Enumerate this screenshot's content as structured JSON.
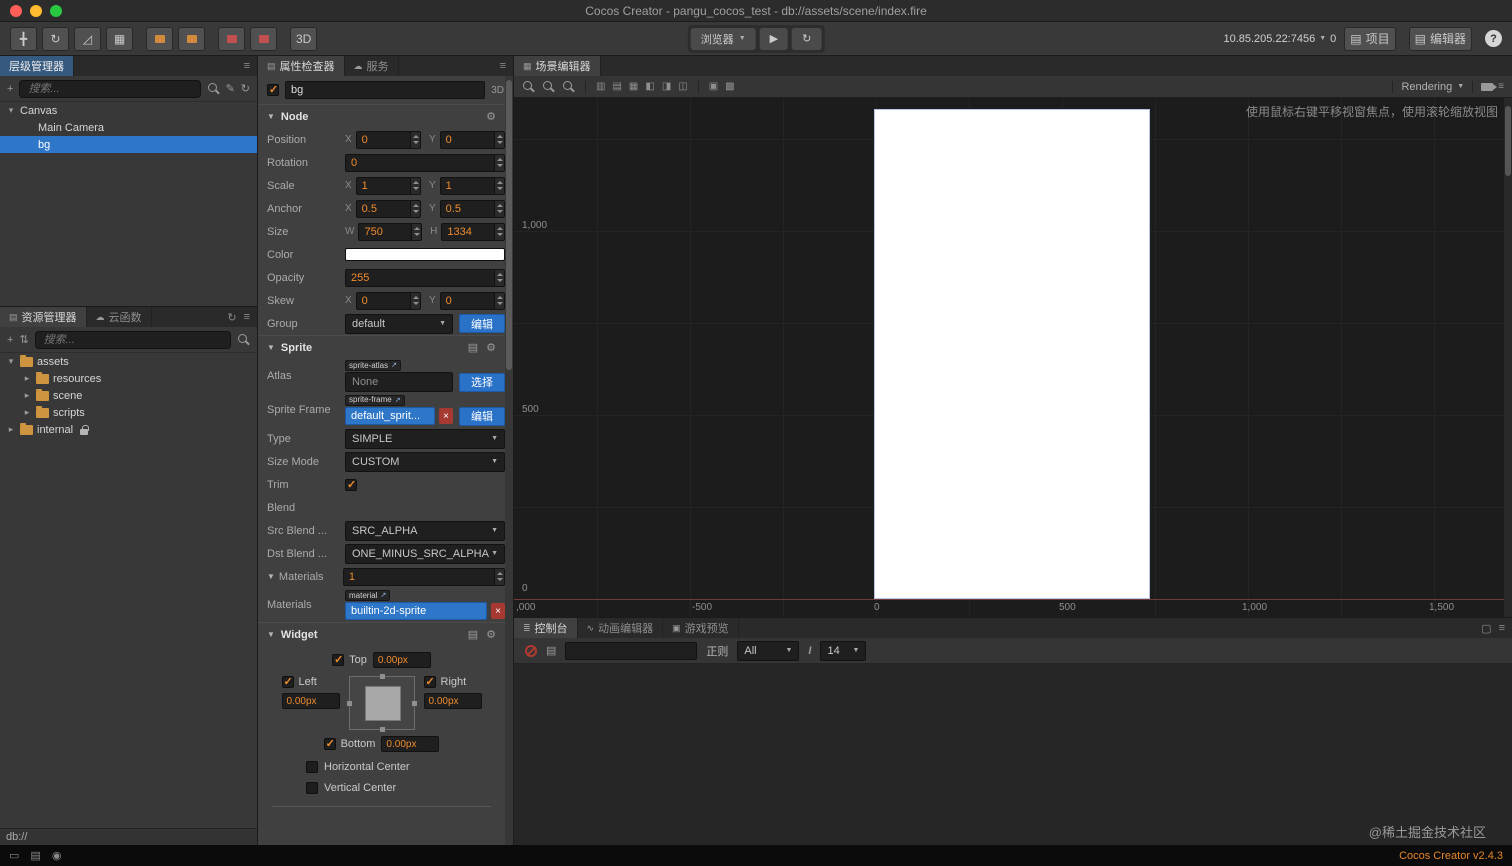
{
  "theme": {
    "accent_blue": "#2d76c8",
    "value_orange": "#f08c2e",
    "button_blue": "#2a72c8",
    "folder_orange": "#cf9440",
    "version_orange": "#e8862a",
    "gizmo_green": "#3aa83a",
    "gizmo_red": "#b03325",
    "gizmo_handle_blue": "#9191e0"
  },
  "icons": {
    "move": "╋",
    "rotate": "↻",
    "scale": "◿",
    "rect": "▦",
    "play": "▶",
    "refresh": "↻",
    "dropdown": "▼",
    "tree_open": "▾",
    "tree_closed": "▸",
    "fold_open": "▼",
    "menu": "≡",
    "add": "+",
    "edit_pencil": "✎",
    "sort": "⇅",
    "gear": "⚙",
    "doc": "▤",
    "link": "↗",
    "close": "×",
    "cloud": "☁",
    "wave": "∿",
    "game": "▣",
    "console": "≣",
    "props": "▤",
    "scene": "▦",
    "assets_tab": "▤",
    "expand": "▢",
    "eye": "◉",
    "monitor": "▭",
    "list": "▤",
    "align1": "▥",
    "align2": "▤",
    "align3": "▦",
    "align4": "◧",
    "align5": "◨",
    "align6": "◫",
    "align7": "▣",
    "align8": "▩",
    "folder_btn": "▤",
    "i_text": "I"
  },
  "titlebar": {
    "title": "Cocos Creator - pangu_cocos_test - db://assets/scene/index.fire"
  },
  "toolbar": {
    "mode_3d": "3D",
    "preview_target": "浏览器",
    "address": "10.85.205.22:7456",
    "connection_count": "0",
    "project_label": "项目",
    "editor_label": "编辑器",
    "help_label": "?"
  },
  "hierarchy": {
    "tab_label": "层级管理器",
    "search_placeholder": "搜索...",
    "nodes": [
      {
        "label": "Canvas"
      },
      {
        "label": "Main Camera"
      },
      {
        "label": "bg"
      }
    ]
  },
  "assets": {
    "tab_assets": "资源管理器",
    "tab_cloud": "云函数",
    "search_placeholder": "搜索...",
    "nodes": [
      {
        "label": "assets"
      },
      {
        "label": "resources"
      },
      {
        "label": "scene"
      },
      {
        "label": "scripts"
      },
      {
        "label": "internal"
      }
    ],
    "footer_path": "db://"
  },
  "inspector": {
    "tab_properties": "属性检查器",
    "tab_services": "服务",
    "node_name": "bg",
    "badge_3d": "3D",
    "node": {
      "title": "Node",
      "x_label": "X",
      "y_label": "Y",
      "w_label": "W",
      "h_label": "H",
      "position_label": "Position",
      "position_x": "0",
      "position_y": "0",
      "rotation_label": "Rotation",
      "rotation_value": "0",
      "scale_label": "Scale",
      "scale_x": "1",
      "scale_y": "1",
      "anchor_label": "Anchor",
      "anchor_x": "0.5",
      "anchor_y": "0.5",
      "size_label": "Size",
      "size_w": "750",
      "size_h": "1334",
      "color_label": "Color",
      "opacity_label": "Opacity",
      "opacity_value": "255",
      "skew_label": "Skew",
      "skew_x": "0",
      "skew_y": "0",
      "group_label": "Group",
      "group_value": "default",
      "group_edit_label": "编辑"
    },
    "sprite": {
      "title": "Sprite",
      "atlas_label": "Atlas",
      "atlas_tag": "sprite-atlas",
      "atlas_value": "None",
      "atlas_btn": "选择",
      "frame_label": "Sprite Frame",
      "frame_tag": "sprite-frame",
      "frame_value": "default_sprit...",
      "frame_btn": "编辑",
      "type_label": "Type",
      "type_value": "SIMPLE",
      "sizemode_label": "Size Mode",
      "sizemode_value": "CUSTOM",
      "trim_label": "Trim",
      "blend_label": "Blend",
      "src_blend_label": "Src Blend ...",
      "src_blend_value": "SRC_ALPHA",
      "dst_blend_label": "Dst Blend ...",
      "dst_blend_value": "ONE_MINUS_SRC_ALPHA",
      "materials_title": "Materials",
      "materials_count": "1",
      "materials_label": "Materials",
      "material_tag": "material",
      "material_value": "builtin-2d-sprite"
    },
    "widget": {
      "title": "Widget",
      "top_label": "Top",
      "top_value": "0.00px",
      "left_label": "Left",
      "left_value": "0.00px",
      "right_label": "Right",
      "right_value": "0.00px",
      "bottom_label": "Bottom",
      "bottom_value": "0.00px",
      "h_center_label": "Horizontal Center",
      "v_center_label": "Vertical Center"
    }
  },
  "scene": {
    "tab_label": "场景编辑器",
    "rendering_label": "Rendering",
    "hint": "使用鼠标右键平移视窗焦点，使用滚轮缩放视图",
    "ruler_y": [
      "1,000",
      "500",
      "0"
    ],
    "ruler_x": [
      ",000",
      "-500",
      "0",
      "500",
      "1,000",
      "1,500"
    ]
  },
  "console": {
    "tab_console": "控制台",
    "tab_animation": "动画编辑器",
    "tab_preview": "游戏预览",
    "regex_label": "正则",
    "filter_value": "All",
    "font_size_value": "14"
  },
  "statusbar": {
    "watermark": "@稀土掘金技术社区",
    "version": "Cocos Creator v2.4.3"
  }
}
